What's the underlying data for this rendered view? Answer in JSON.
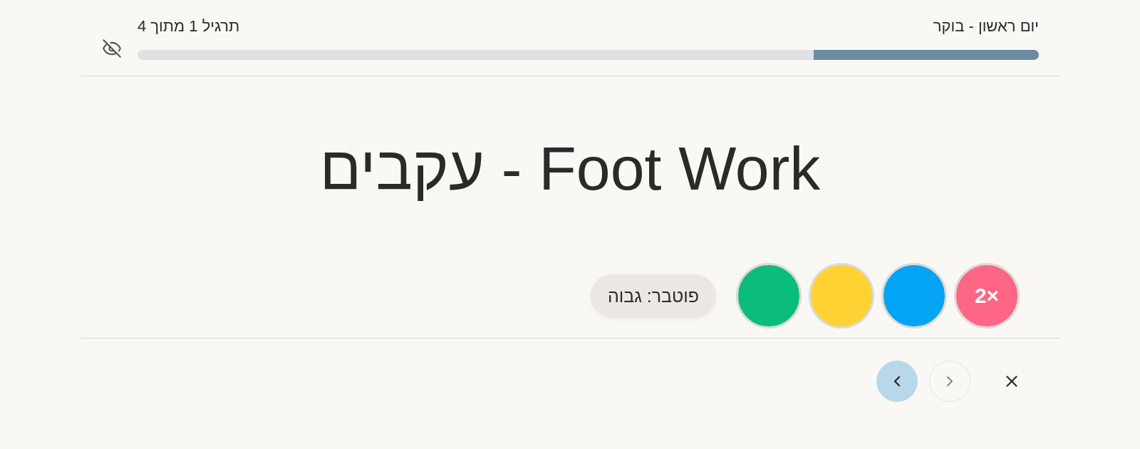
{
  "header": {
    "session_title": "יום ראשון - בוקר",
    "exercise_counter": "תרגיל 1 מתוך 4",
    "progress": {
      "level": 0.25
    }
  },
  "exercise": {
    "title": "Foot Work - עקבים",
    "markers": [
      {
        "color": "#ff6584",
        "label": "2×"
      },
      {
        "color": "#04a4f4"
      },
      {
        "color": "#fed233"
      },
      {
        "color": "#0bbd7b"
      }
    ],
    "tag": "פוטבר: גבוה"
  },
  "nav_buttons": [
    {
      "kind": "close",
      "disabled": false
    },
    {
      "kind": "previous",
      "disabled": true
    },
    {
      "kind": "next",
      "disabled": false
    }
  ]
}
